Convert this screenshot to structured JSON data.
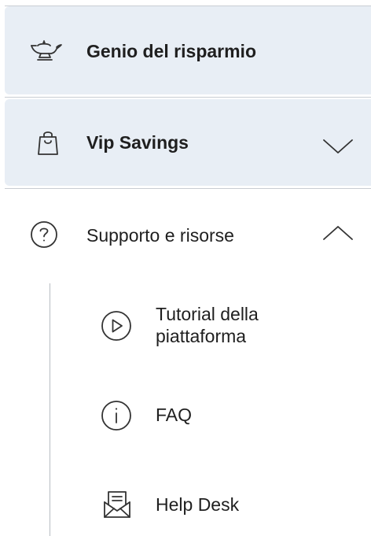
{
  "menu": {
    "genio": {
      "label": "Genio del risparmio",
      "icon": "lamp-icon"
    },
    "vip": {
      "label": "Vip Savings",
      "icon": "shopping-bag-icon",
      "chevron": "chevron-down-icon"
    },
    "support": {
      "label": "Supporto e risorse",
      "icon": "question-circle-icon",
      "chevron": "chevron-up-icon"
    },
    "sub_items": [
      {
        "label_line1": "Tutorial della",
        "label_line2": "piattaforma",
        "icon": "play-circle-icon"
      },
      {
        "label": "FAQ",
        "icon": "info-circle-icon"
      },
      {
        "label": "Help Desk",
        "icon": "envelope-open-icon"
      }
    ]
  },
  "colors": {
    "highlight_bg": "#e8eef5",
    "divider": "#c9cdd3",
    "text": "#1f1f1f"
  }
}
